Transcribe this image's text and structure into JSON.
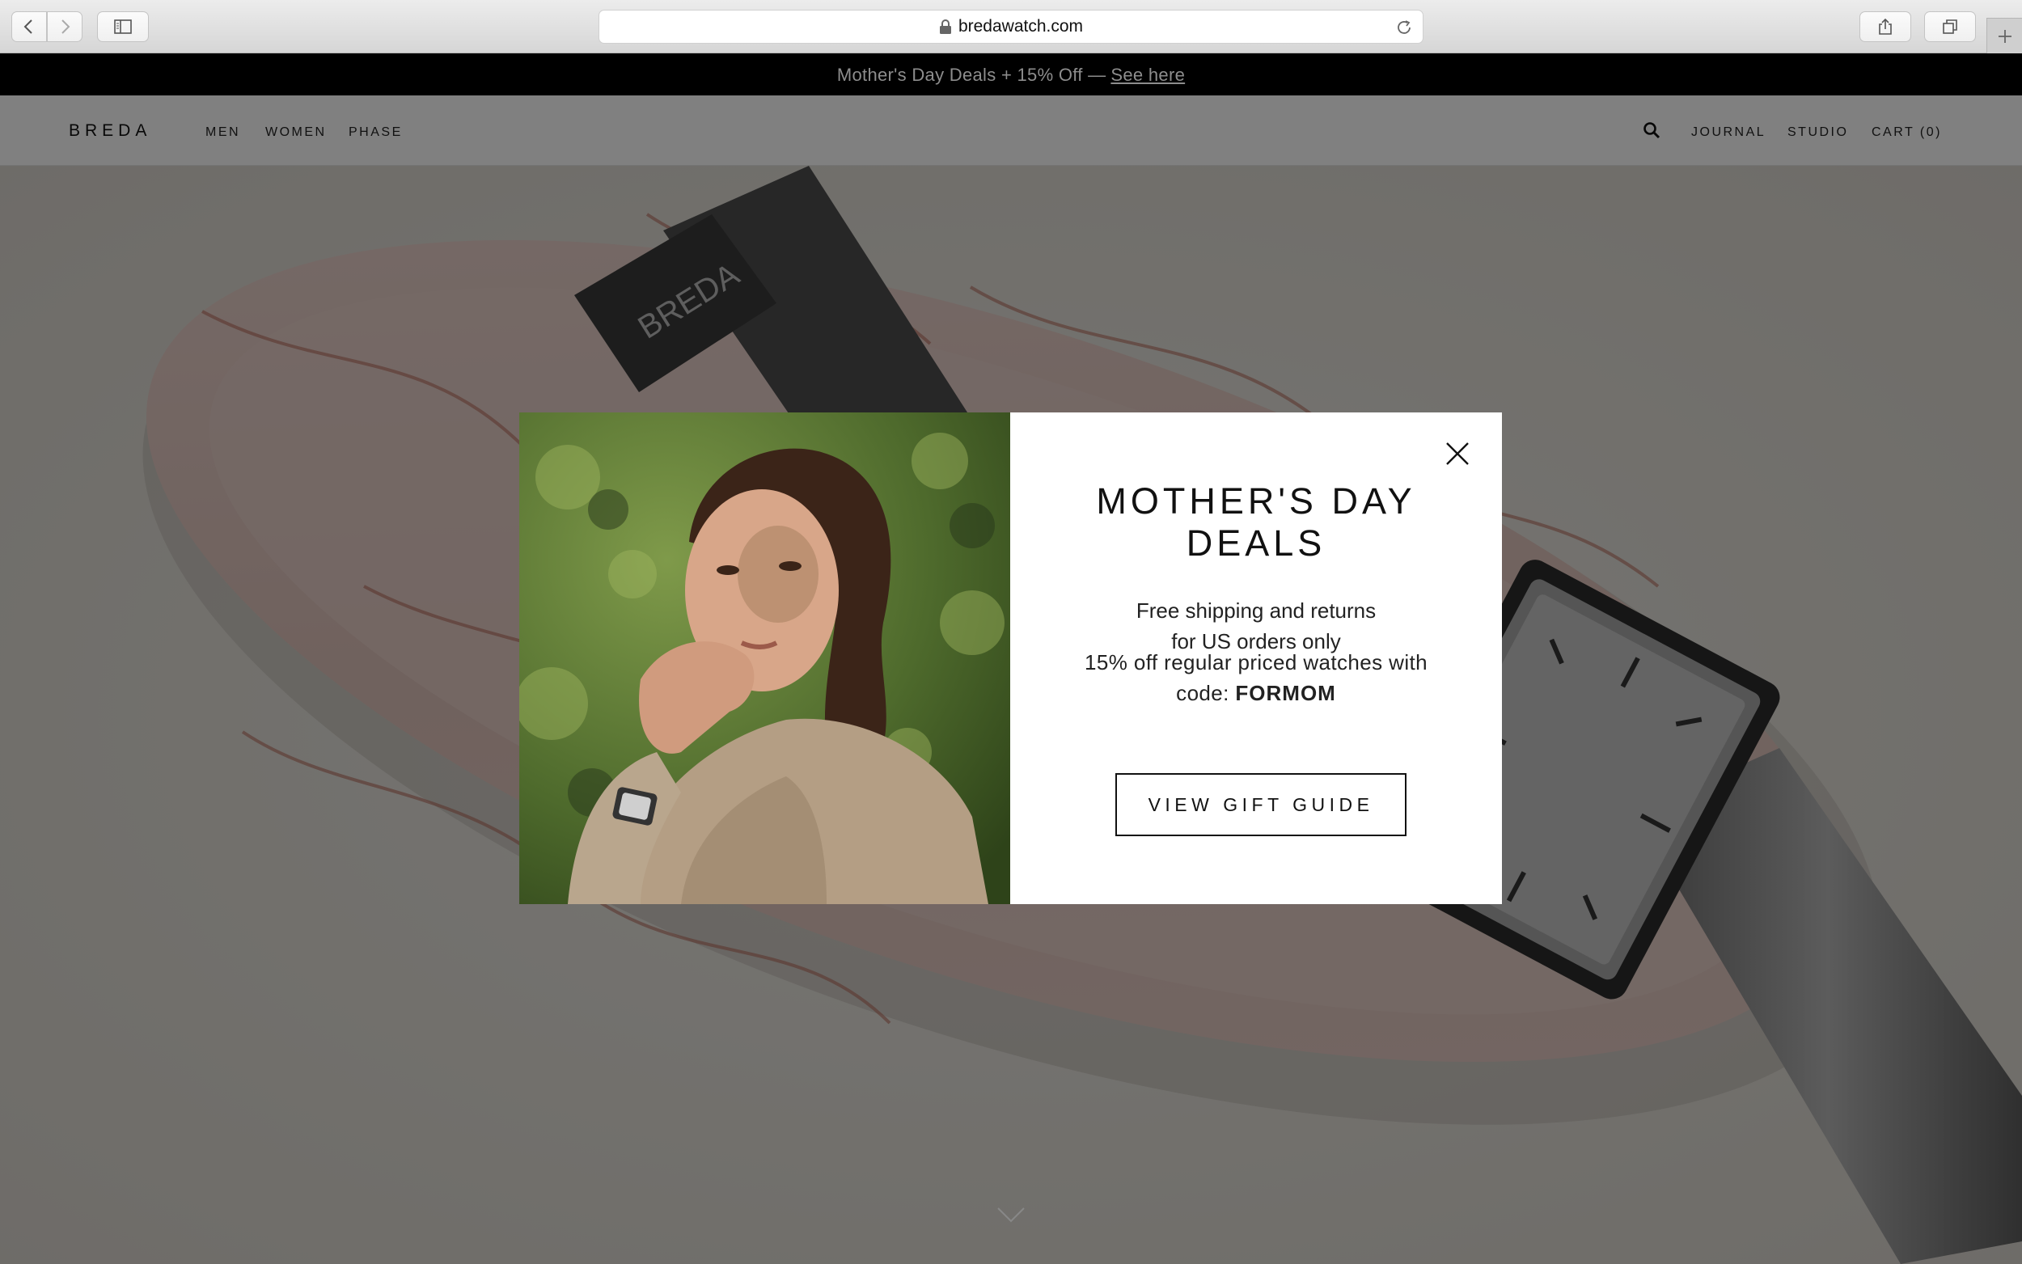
{
  "browser": {
    "url": "bredawatch.com",
    "icons": [
      "back-icon",
      "forward-icon",
      "sidebar-icon",
      "lock-icon",
      "reload-icon",
      "share-icon",
      "tabs-icon",
      "plus-icon"
    ]
  },
  "promo_bar": {
    "text": "Mother's Day Deals + 15% Off —",
    "link": "See here"
  },
  "site_nav": {
    "logo": "BREDA",
    "left_links": [
      "MEN",
      "WOMEN",
      "PHASE"
    ],
    "right_links": [
      "JOURNAL",
      "STUDIO",
      "CART (0)"
    ]
  },
  "modal": {
    "title_line1": "MOTHER'S DAY",
    "title_line2": "DEALS",
    "shipping_line1": "Free shipping and returns",
    "shipping_line2": "for US orders only",
    "discount_line1": "15% off regular priced watches with",
    "discount_prefix": "code:",
    "discount_code": "FORMOM",
    "button_label": "VIEW GIFT GUIDE"
  },
  "colors": {
    "promo_bg": "#000000",
    "promo_text": "#8d8d8d",
    "overlay": "rgba(0,0,0,0.49)",
    "modal_bg": "#ffffff",
    "text": "#111111"
  }
}
